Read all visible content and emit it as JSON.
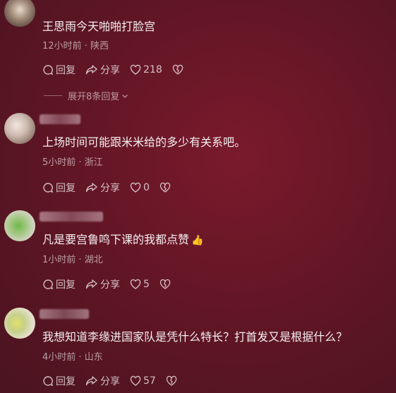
{
  "comments": [
    {
      "text": "王思雨今天啪啪打脸宫",
      "meta": "12小时前 · 陕西",
      "reply_label": "回复",
      "share_label": "分享",
      "likes": "218"
    },
    {
      "text": "上场时间可能跟米米给的多少有关系吧。",
      "meta": "5小时前 · 浙江",
      "reply_label": "回复",
      "share_label": "分享",
      "likes": "0"
    },
    {
      "text": "凡是要宫鲁鸣下课的我都点赞",
      "meta": "1小时前 · 湖北",
      "reply_label": "回复",
      "share_label": "分享",
      "likes": "5"
    },
    {
      "text": "我想知道李缘进国家队是凭什么特长？打首发又是根据什么？",
      "meta": "4小时前 · 山东",
      "reply_label": "回复",
      "share_label": "分享",
      "likes": "57"
    }
  ],
  "expand_replies": "展开8条回复",
  "icons": {
    "reply": "reply-bubble-icon",
    "share": "share-arrow-icon",
    "like": "heart-icon",
    "dislike": "broken-heart-icon",
    "thumb": "thumbs-up-emoji"
  },
  "colors": {
    "background": "#6a1828",
    "text": "#f4eef0",
    "meta": "#c9a9b1"
  }
}
